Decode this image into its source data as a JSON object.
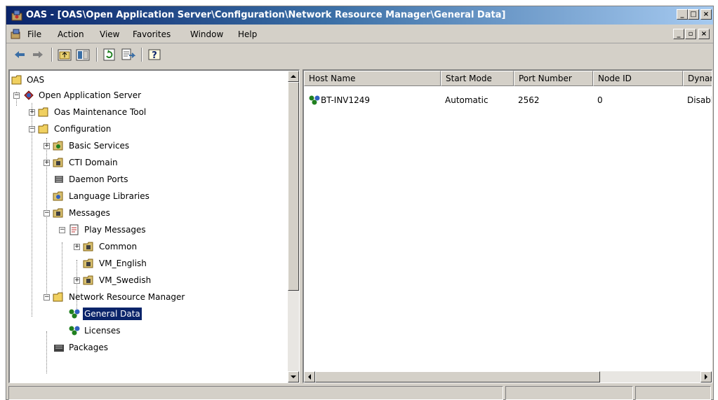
{
  "title_bar": {
    "title": "OAS - [OAS\\Open Application Server\\Configuration\\Network Resource Manager\\General Data]"
  },
  "window_controls": {
    "minimize": "_",
    "maximize": "□",
    "close": "×"
  },
  "doc_controls": {
    "minimize": "_",
    "restore": "▫",
    "close": "×"
  },
  "menu": {
    "file": "File",
    "action": "Action",
    "view": "View",
    "favorites": "Favorites",
    "window": "Window",
    "help": "Help"
  },
  "toolbar": {
    "icons": [
      "back-arrow-icon",
      "forward-arrow-icon",
      "up-folder-icon",
      "show-hide-tree-icon",
      "refresh-icon",
      "export-list-icon",
      "help-icon"
    ]
  },
  "tree": {
    "items": [
      {
        "label": "OAS"
      },
      {
        "label": "Open Application Server"
      },
      {
        "label": "Oas Maintenance Tool"
      },
      {
        "label": "Configuration"
      },
      {
        "label": "Basic Services"
      },
      {
        "label": "CTI Domain"
      },
      {
        "label": "Daemon Ports"
      },
      {
        "label": "Language Libraries"
      },
      {
        "label": "Messages"
      },
      {
        "label": "Play Messages"
      },
      {
        "label": "Common"
      },
      {
        "label": "VM_English"
      },
      {
        "label": "VM_Swedish"
      },
      {
        "label": "Network Resource Manager"
      },
      {
        "label": "General Data"
      },
      {
        "label": "Licenses"
      },
      {
        "label": "Packages"
      }
    ]
  },
  "list": {
    "columns": [
      "Host Name",
      "Start Mode",
      "Port Number",
      "Node ID",
      "Dynam"
    ],
    "rows": [
      {
        "host_name": "BT-INV1249",
        "start_mode": "Automatic",
        "port_number": "2562",
        "node_id": "0",
        "dynamic": "Disable"
      }
    ]
  },
  "colors": {
    "selection": "#0a246a",
    "titlebar_start": "#0a246a",
    "titlebar_end": "#a6caf0",
    "chrome": "#d4d0c8"
  }
}
